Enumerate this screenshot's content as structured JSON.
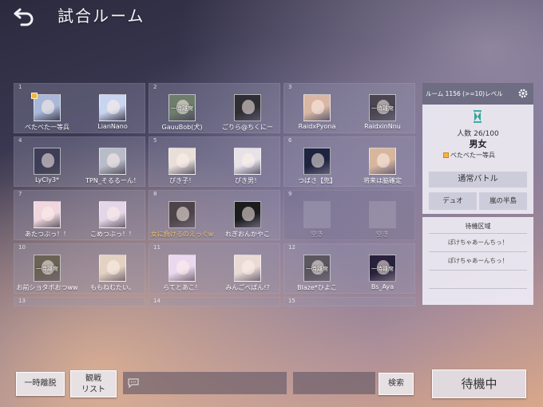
{
  "header": {
    "title": "試合ルーム"
  },
  "slots": [
    {
      "num": "1",
      "players": [
        {
          "name": "べたべた一等兵",
          "badge": true,
          "avatar": "#a9b8d8",
          "afk": ""
        },
        {
          "name": "LianNano",
          "avatar": "#c9d4ee",
          "afk": ""
        }
      ]
    },
    {
      "num": "2",
      "players": [
        {
          "name": "GauuBob(犬)",
          "avatar": "#6f7e6c",
          "afk": "一時離席"
        },
        {
          "name": "ごりら@ちくにー",
          "avatar": "#2e2e34",
          "afk": ""
        }
      ]
    },
    {
      "num": "3",
      "players": [
        {
          "name": "RaidxPyona",
          "avatar": "#d9b7a4",
          "afk": ""
        },
        {
          "name": "RaidxinNnu",
          "avatar": "#4a4550",
          "afk": "一時離席"
        }
      ]
    },
    {
      "num": "4",
      "players": [
        {
          "name": "LyCly3*",
          "avatar": "#3d3d57",
          "afk": ""
        },
        {
          "name": "TPN_そるるーん！",
          "avatar": "#b8bcc8",
          "afk": ""
        }
      ]
    },
    {
      "num": "5",
      "players": [
        {
          "name": "ぴき子！",
          "avatar": "#e8dfd8",
          "afk": ""
        },
        {
          "name": "ぴき男！",
          "avatar": "#e6e2e8",
          "afk": ""
        }
      ]
    },
    {
      "num": "6",
      "players": [
        {
          "name": "つばさ【兜】",
          "avatar": "#1e2340",
          "afk": ""
        },
        {
          "name": "将来は脇確定",
          "avatar": "#d8b69d",
          "afk": ""
        }
      ]
    },
    {
      "num": "7",
      "players": [
        {
          "name": "あたつぶっ！！",
          "avatar": "#f0d6de",
          "afk": ""
        },
        {
          "name": "こめつぶっ！！",
          "avatar": "#e4d6e8",
          "afk": ""
        }
      ]
    },
    {
      "num": "8",
      "players": [
        {
          "name": "女に負けるのえっぐw",
          "gold": true,
          "avatar": "#4d4449",
          "afk": ""
        },
        {
          "name": "れぎおんかやこ",
          "avatar": "#1c1c1f",
          "afk": ""
        }
      ]
    },
    {
      "num": "9",
      "players": [
        {
          "name": "空き",
          "empty": true
        },
        {
          "name": "空き",
          "empty": true
        }
      ]
    },
    {
      "num": "10",
      "players": [
        {
          "name": "お前ショタボおつww",
          "avatar": "#6a6255",
          "afk": "一時離席"
        },
        {
          "name": "ももねむたい。",
          "avatar": "#e3d2c2",
          "afk": ""
        }
      ]
    },
    {
      "num": "11",
      "players": [
        {
          "name": "らてとあこ！",
          "avatar": "#ead8ee",
          "afk": ""
        },
        {
          "name": "みんごべばん!?",
          "avatar": "#eadad6",
          "afk": ""
        }
      ]
    },
    {
      "num": "12",
      "players": [
        {
          "name": "Blaze*ひよこ",
          "avatar": "#5b5660",
          "afk": "一時離席"
        },
        {
          "name": "Bs_Aya",
          "avatar": "#28213c",
          "afk": "一時離席"
        }
      ]
    },
    {
      "num": "13",
      "players": []
    },
    {
      "num": "14",
      "players": []
    },
    {
      "num": "15",
      "players": []
    }
  ],
  "room": {
    "header": "ルーム 1156 (>=10)レベル",
    "count": "人数 26/100",
    "mode": "男女",
    "host": "べたべた一等兵",
    "rule_main": "通常バトル",
    "rule_a": "デュオ",
    "rule_b": "嵐の半島"
  },
  "waiting": {
    "title": "待機区域",
    "rows": [
      "ぽけちゃあーんちっ！",
      "ぽけちゃあーんちっ！",
      "",
      ""
    ]
  },
  "footer": {
    "leave": "一時離脱",
    "watch_line1": "観戦",
    "watch_line2": "リスト",
    "chat_value": "",
    "search_value": "",
    "search_button": "検索",
    "ready_button": "待機中"
  },
  "colors": {
    "badge": "#f5b53d",
    "highlight_name": "#f2c66b"
  }
}
